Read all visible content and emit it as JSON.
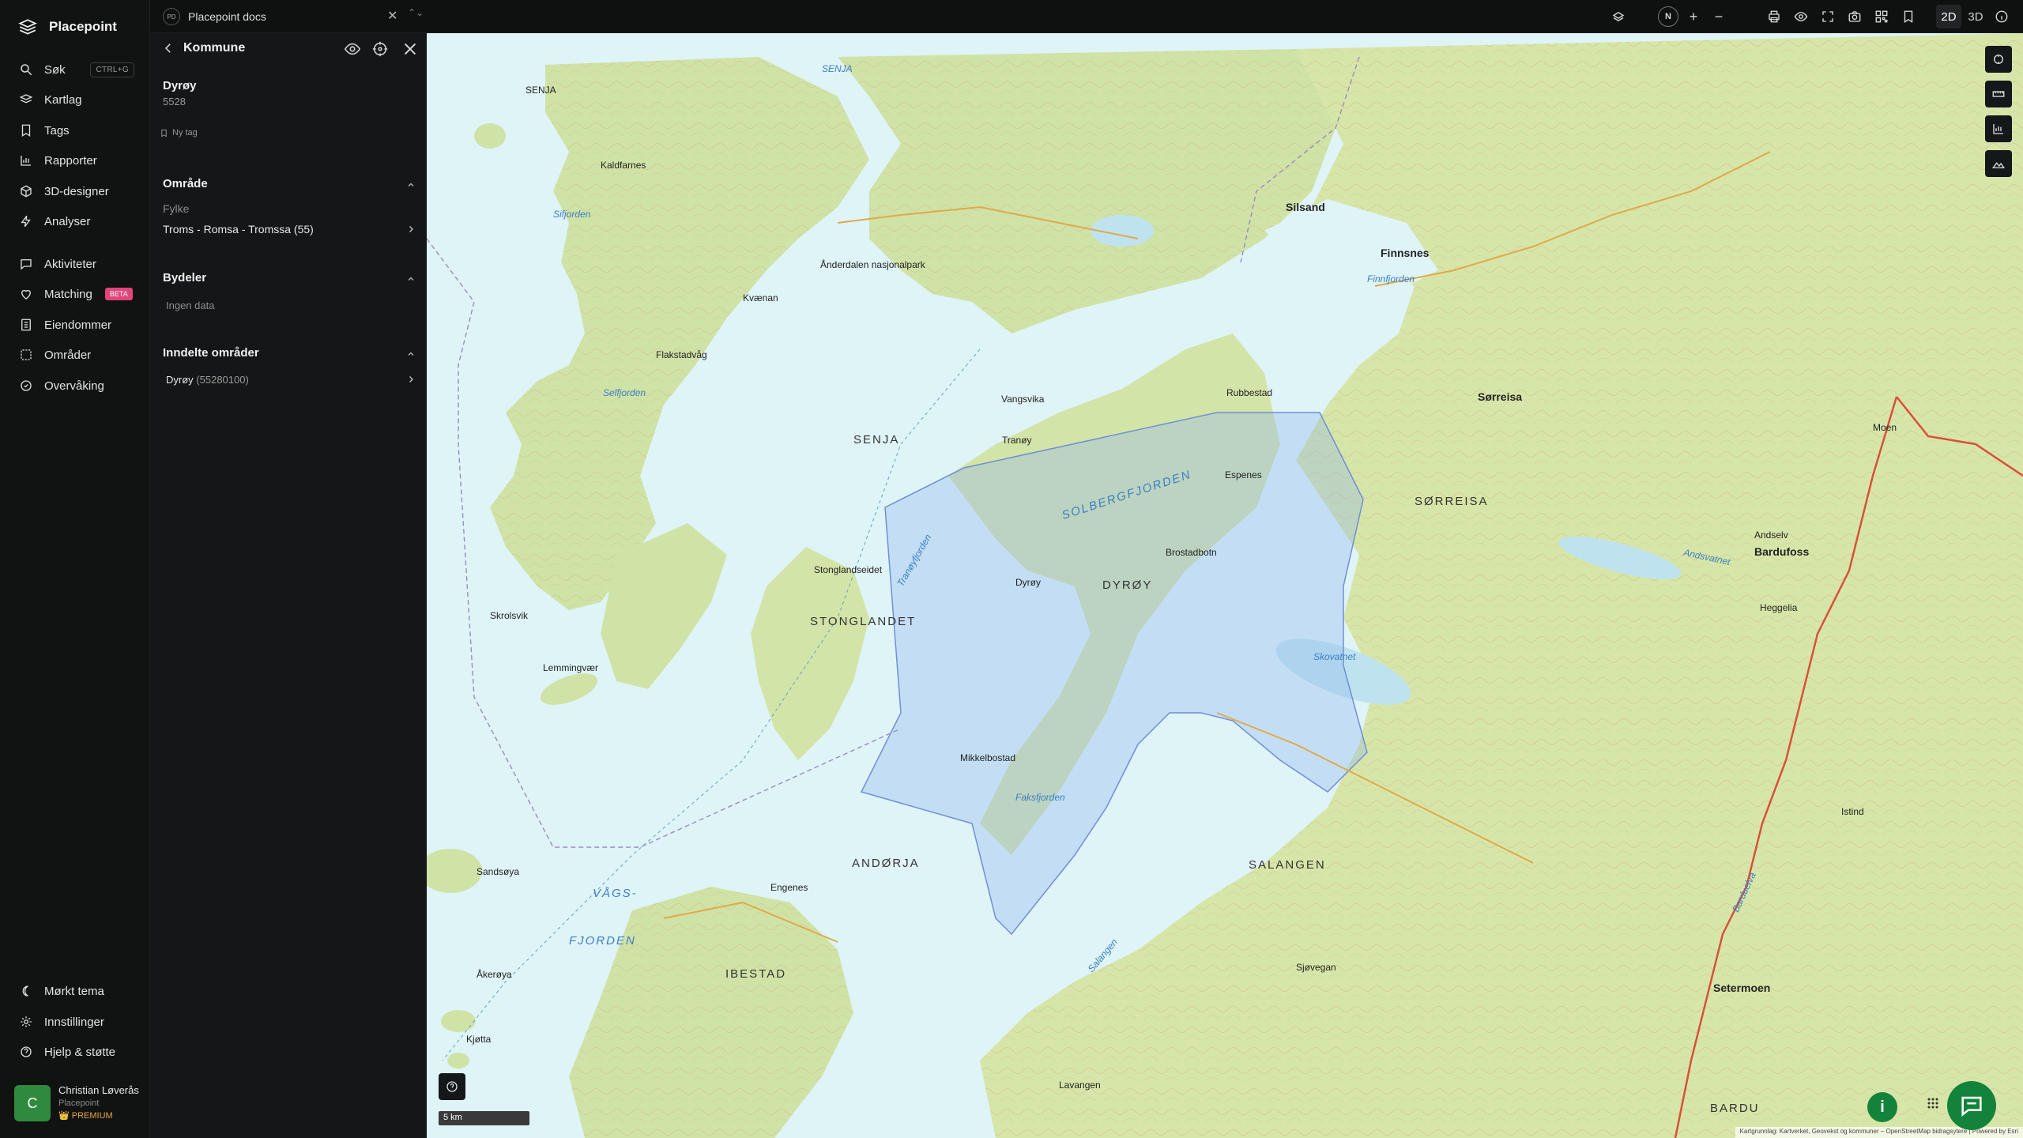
{
  "app": {
    "name": "Placepoint"
  },
  "nav": {
    "items": [
      {
        "label": "Søk",
        "shortcut": "CTRL+G",
        "icon": "search-icon"
      },
      {
        "label": "Kartlag",
        "icon": "layers-icon"
      },
      {
        "label": "Tags",
        "icon": "bookmark-icon"
      },
      {
        "label": "Rapporter",
        "icon": "bar-chart-icon"
      },
      {
        "label": "3D-designer",
        "icon": "cube-icon"
      },
      {
        "label": "Analyser",
        "icon": "bolt-icon"
      },
      {
        "label": "Aktiviteter",
        "icon": "activity-icon"
      },
      {
        "label": "Matching",
        "badge": "BETA",
        "icon": "matching-icon"
      },
      {
        "label": "Eiendommer",
        "icon": "building-icon"
      },
      {
        "label": "Områder",
        "icon": "area-icon"
      },
      {
        "label": "Overvåking",
        "icon": "radar-icon"
      }
    ],
    "bottom": [
      {
        "label": "Mørkt tema",
        "icon": "moon-icon"
      },
      {
        "label": "Innstillinger",
        "icon": "gear-icon"
      },
      {
        "label": "Hjelp & støtte",
        "icon": "help-icon"
      }
    ],
    "user": {
      "initial": "C",
      "name": "Christian Løverås",
      "org": "Placepoint",
      "plan": "PREMIUM"
    }
  },
  "tab": {
    "badge": "PD",
    "title": "Placepoint docs"
  },
  "toolbar": {
    "compass": "N",
    "zoom_in": "+",
    "zoom_out": "−",
    "mode_2d": "2D",
    "mode_3d": "3D"
  },
  "panel": {
    "title": "Kommune",
    "name": "Dyrøy",
    "code": "5528",
    "new_tag": "Ny tag",
    "sections": {
      "omrade": {
        "title": "Område",
        "sub": "Fylke",
        "row": "Troms - Romsa - Tromssa (55)"
      },
      "bydeler": {
        "title": "Bydeler",
        "empty": "Ingen data"
      },
      "inndelte": {
        "title": "Inndelte områder",
        "row_name": "Dyrøy",
        "row_code": "(55280100)"
      }
    }
  },
  "map": {
    "scale": "5 km",
    "attribution": "Kartgrunnlag: Kartverket, Geovekst og kommuner – OpenStreetMap bidragsytere | Powered by Esri",
    "labels": {
      "senja": "SENJA",
      "senja2": "SENJA",
      "anderdalen": "Ånderdalen nasjonalpark",
      "kvaenan": "Kvænan",
      "sifjorden": "Sifjorden",
      "selfjorden": "Selfjorden",
      "flakstadvag": "Flakstadvåg",
      "kaldfarnes": "Kaldfarnes",
      "skrolsvik": "Skrolsvik",
      "lemmingvaer": "Lemmingvær",
      "stonglandet": "STONGLANDET",
      "stonglandseidet": "Stonglandseidet",
      "vangsvik": "Vangsvika",
      "tranoy": "Tranøy",
      "solbergfjorden": "SOLBERGFJORDEN",
      "tranoyfjorden": "Tranøyfjorden",
      "dyroy": "DYRØY",
      "dyroy_isl": "Dyrøy",
      "brostadbotn": "Brostadbotn",
      "faksfjorden": "Faksfjorden",
      "mikkelbostad": "Mikkelbostad",
      "andorja": "ANDØRJA",
      "vagsfjorden1": "VÅGS-",
      "vagsfjorden2": "FJORDEN",
      "ibestad": "IBESTAD",
      "salangen": "SALANGEN",
      "sorreisa": "SØRREISA",
      "sorreisa_t": "Sørreisa",
      "finnsnes": "Finnsnes",
      "silsand": "Silsand",
      "finnfjorden": "Finnfjorden",
      "skovatnet": "Skovatnet",
      "bardufoss": "Bardufoss",
      "andselv": "Andselv",
      "sjovegan": "Sjøvegan",
      "setermoen": "Setermoen",
      "bardu": "BARDU",
      "istind": "Istind",
      "lavangen": "Lavangen",
      "rubbestad": "Rubbestad",
      "espenes": "Espenes",
      "engenes": "Engenes",
      "sandsoya": "Sandsøya",
      "akeroya": "Åkerøya",
      "kjotta": "Kjøtta",
      "salangen_w": "Salangen",
      "bardu_river": "Barduelva",
      "andsvatnet": "Andsvatnet",
      "moen": "Moen",
      "heggelia": "Heggelia",
      "senja_nw": "SENJA"
    }
  }
}
